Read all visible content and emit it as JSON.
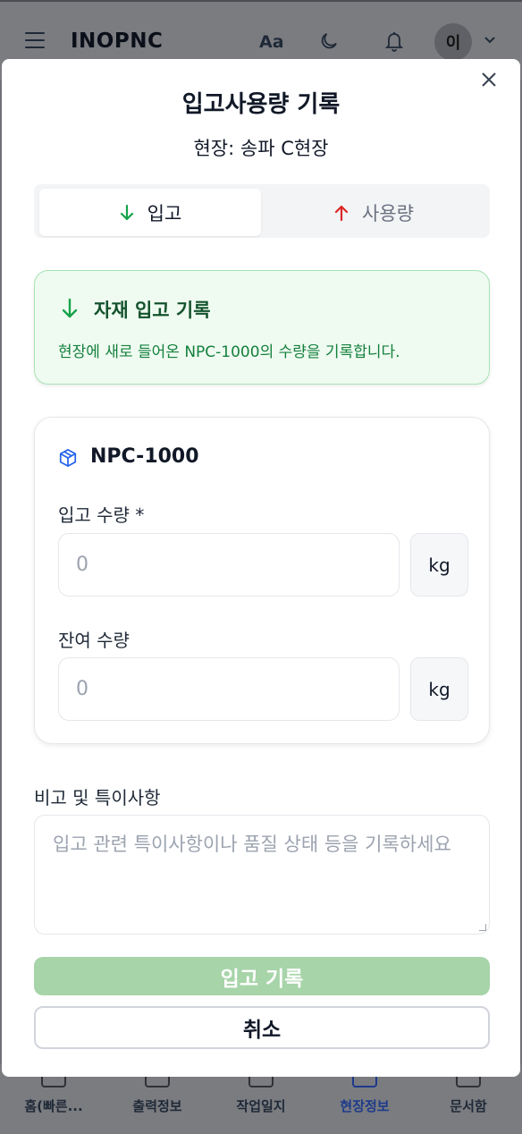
{
  "header": {
    "brand": "INOPNC",
    "font_toggle": "Aa",
    "avatar_initial": "이",
    "icons": [
      "menu-icon",
      "moon-icon",
      "bell-icon",
      "chevron-down-icon"
    ]
  },
  "bottom_nav": {
    "items": [
      {
        "label": "홈(빠른...",
        "icon": "home-grid-icon",
        "active": false
      },
      {
        "label": "출력정보",
        "icon": "calendar-icon",
        "active": false
      },
      {
        "label": "작업일지",
        "icon": "document-icon",
        "active": false
      },
      {
        "label": "현장정보",
        "icon": "map-pin-icon",
        "active": true
      },
      {
        "label": "문서함",
        "icon": "folder-icon",
        "active": false
      }
    ]
  },
  "modal": {
    "title": "입고사용량 기록",
    "subtitle": "현장: 송파 C현장",
    "tabs": [
      {
        "label": "입고",
        "icon": "arrow-down-icon",
        "color": "#16a34a",
        "selected": true
      },
      {
        "label": "사용량",
        "icon": "arrow-up-icon",
        "color": "#dc2626",
        "selected": false
      }
    ],
    "info": {
      "title": "자재 입고 기록",
      "description": "현장에 새로 들어온 NPC-1000의 수량을 기록합니다."
    },
    "material": {
      "name": "NPC-1000",
      "icon": "package-icon",
      "inbound_label": "입고 수량 *",
      "inbound_value": "0",
      "inbound_unit": "kg",
      "remaining_label": "잔여 수량",
      "remaining_value": "0",
      "remaining_unit": "kg"
    },
    "notes": {
      "label": "비고 및 특이사항",
      "placeholder": "입고 관련 특이사항이나 품질 상태 등을 기록하세요"
    },
    "submit_label": "입고 기록",
    "cancel_label": "취소"
  },
  "colors": {
    "accent_green": "#16a34a",
    "submit_disabled": "#a7d4a9",
    "info_bg": "#effbf1"
  }
}
